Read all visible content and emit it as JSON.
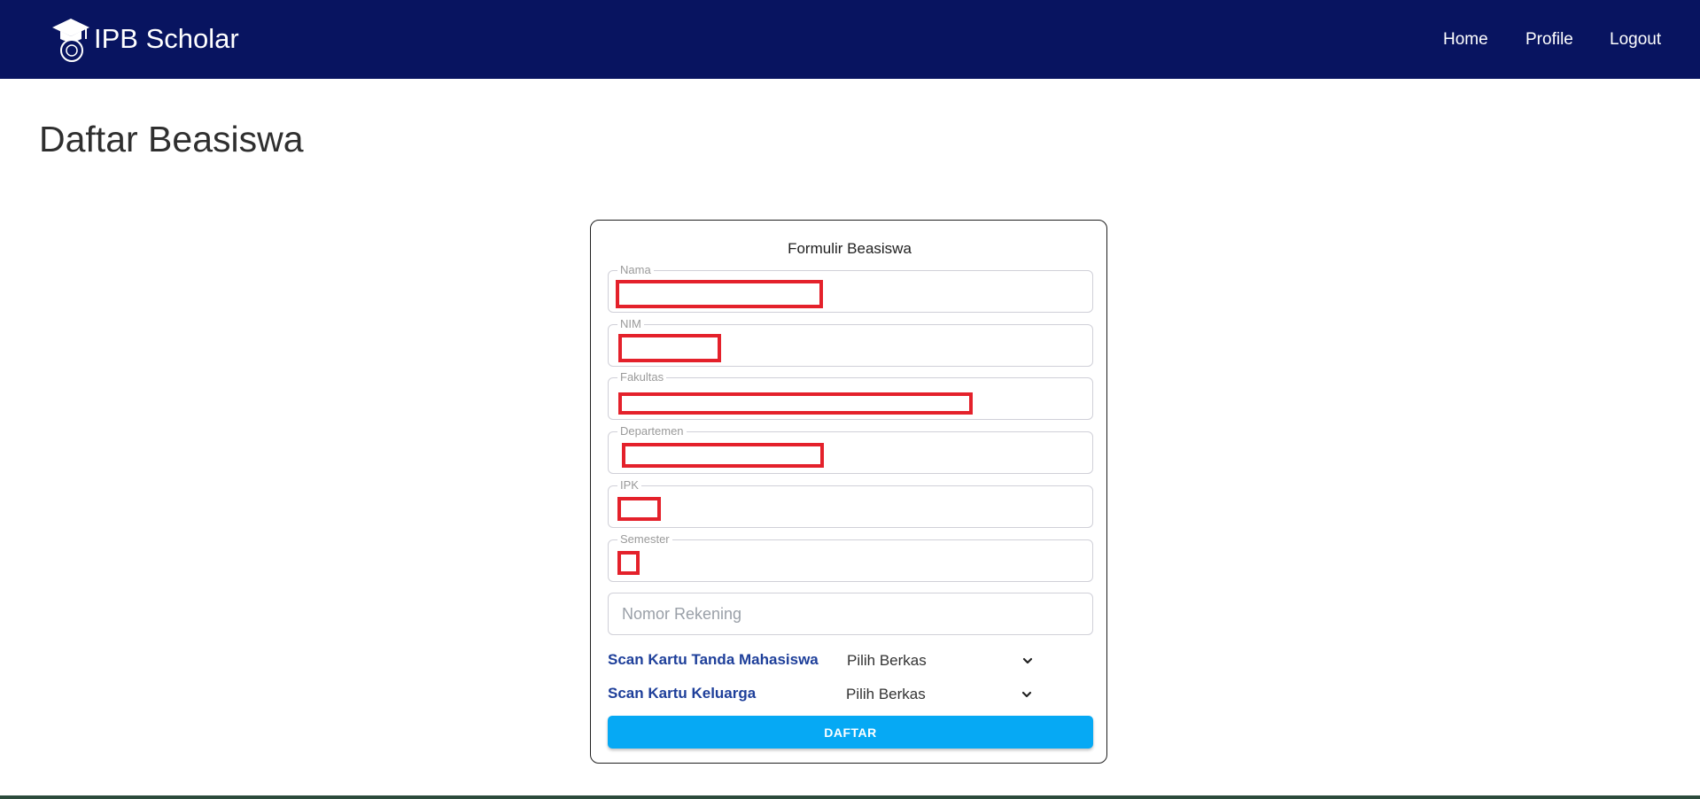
{
  "colors": {
    "navbar": "#081460",
    "accent_button": "#06a9f4",
    "file_label": "#1e3f9a",
    "redaction": "#e4212b"
  },
  "navbar": {
    "brand_text": "IPB Scholar",
    "brand_icon": "graduation-cap-logo-icon",
    "links": [
      {
        "label": "Home"
      },
      {
        "label": "Profile"
      },
      {
        "label": "Logout"
      }
    ]
  },
  "page": {
    "title": "Daftar Beasiswa"
  },
  "form": {
    "title": "Formulir Beasiswa",
    "fields": [
      {
        "label": "Nama",
        "value": "",
        "redacted": true
      },
      {
        "label": "NIM",
        "value": "",
        "redacted": true
      },
      {
        "label": "Fakultas",
        "value": "",
        "redacted": true
      },
      {
        "label": "Departemen",
        "value": "",
        "redacted": true
      },
      {
        "label": "IPK",
        "value": "",
        "redacted": true
      },
      {
        "label": "Semester",
        "value": "",
        "redacted": true
      }
    ],
    "account_input": {
      "placeholder": "Nomor Rekening",
      "value": ""
    },
    "uploads": [
      {
        "label": "Scan Kartu Tanda Mahasiswa",
        "select_value": "Pilih Berkas",
        "icon": "chevron-down-icon"
      },
      {
        "label": "Scan Kartu Keluarga",
        "select_value": "Pilih Berkas",
        "icon": "chevron-down-icon"
      }
    ],
    "submit_label": "DAFTAR"
  }
}
